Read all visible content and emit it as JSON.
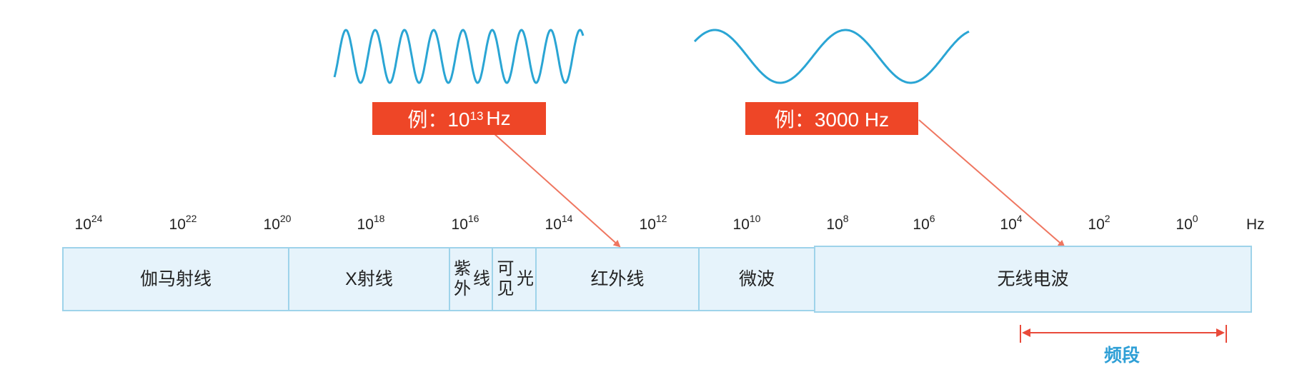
{
  "axis": {
    "ticks": [
      {
        "base": "10",
        "exp": "24"
      },
      {
        "base": "10",
        "exp": "22"
      },
      {
        "base": "10",
        "exp": "20"
      },
      {
        "base": "10",
        "exp": "18"
      },
      {
        "base": "10",
        "exp": "16"
      },
      {
        "base": "10",
        "exp": "14"
      },
      {
        "base": "10",
        "exp": "12"
      },
      {
        "base": "10",
        "exp": "10"
      },
      {
        "base": "10",
        "exp": "8"
      },
      {
        "base": "10",
        "exp": "6"
      },
      {
        "base": "10",
        "exp": "4"
      },
      {
        "base": "10",
        "exp": "2"
      },
      {
        "base": "10",
        "exp": "0"
      }
    ],
    "unit": "Hz"
  },
  "bands": {
    "gamma": "伽马射线",
    "xray": "X射线",
    "uv": "紫外线",
    "visible": "可见光",
    "infrared": "红外线",
    "microwave": "微波",
    "radio": "无线电波"
  },
  "callouts": {
    "high": {
      "prefix": "例：10",
      "exp": "13",
      "suffix": "Hz"
    },
    "low": {
      "text": "例：3000 Hz"
    }
  },
  "band_range_label": "频段",
  "colors": {
    "wave": "#2aa5d4",
    "callout": "#ee4627",
    "arrow": "#ef7660",
    "band_fill": "#e6f3fb",
    "band_border": "#9ed3ea",
    "band_label": "#2e9fd6"
  }
}
